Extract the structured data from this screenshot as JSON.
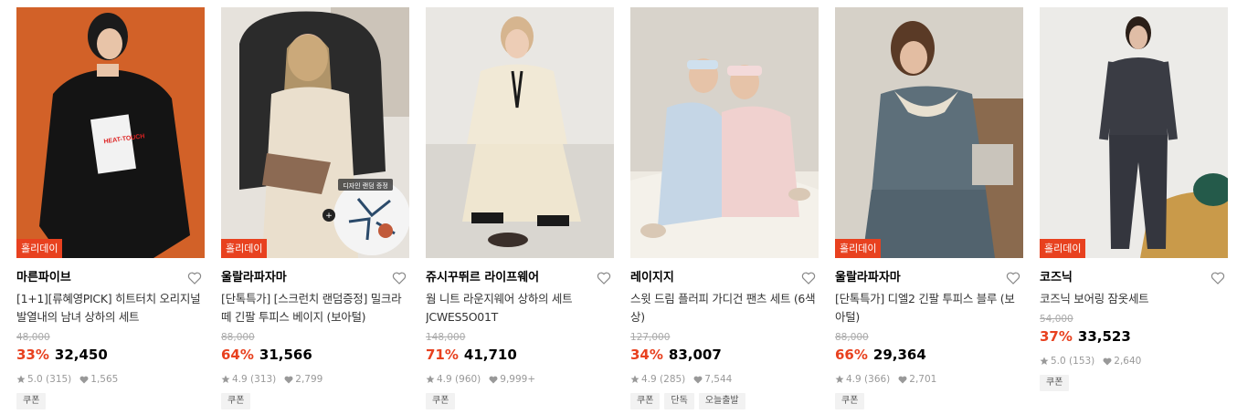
{
  "colors": {
    "accent": "#e8411f",
    "badge_bg": "#e8411f",
    "strike": "#aaaaaa",
    "tag_bg": "#f2f2f2"
  },
  "products": [
    {
      "badge": "홀리데이",
      "brand": "마른파이브",
      "name": "[1+1][류혜영PICK] 히트터치 오리지널 발열내의 남녀 상하의 세트",
      "original_price": "48,000",
      "discount": "33%",
      "price": "32,450",
      "rating": "5.0 (315)",
      "likes": "1,565",
      "tags": [
        "쿠폰"
      ],
      "image_text": "HEAT-TOUCH"
    },
    {
      "badge": "홀리데이",
      "brand": "울랄라파자마",
      "name": "[단톡특가] [스크런치 랜덤증정] 밀크라떼 긴팔 투피스 베이지 (보아털)",
      "original_price": "88,000",
      "discount": "64%",
      "price": "31,566",
      "rating": "4.9 (313)",
      "likes": "2,799",
      "tags": [
        "쿠폰"
      ],
      "image_text": "디자인 랜덤 증정"
    },
    {
      "brand": "쥬시꾸뛰르 라이프웨어",
      "name": "웜 니트 라운지웨어 상하의 세트 JCWES5O01T",
      "original_price": "148,000",
      "discount": "71%",
      "price": "41,710",
      "rating": "4.9 (960)",
      "likes": "9,999+",
      "tags": [
        "쿠폰"
      ]
    },
    {
      "brand": "레이지지",
      "name": "스윗 드림 플러피 가디건 팬츠 세트 (6색상)",
      "original_price": "127,000",
      "discount": "34%",
      "price": "83,007",
      "rating": "4.9 (285)",
      "likes": "7,544",
      "tags": [
        "쿠폰",
        "단독",
        "오늘출발"
      ]
    },
    {
      "badge": "홀리데이",
      "brand": "울랄라파자마",
      "name": "[단톡특가] 디엘2 긴팔 투피스 블루 (보아털)",
      "original_price": "88,000",
      "discount": "66%",
      "price": "29,364",
      "rating": "4.9 (366)",
      "likes": "2,701",
      "tags": [
        "쿠폰"
      ]
    },
    {
      "badge": "홀리데이",
      "brand": "코즈닉",
      "name": "코즈닉 보어링 잠옷세트",
      "original_price": "54,000",
      "discount": "37%",
      "price": "33,523",
      "rating": "5.0 (153)",
      "likes": "2,640",
      "tags": [
        "쿠폰"
      ]
    }
  ]
}
